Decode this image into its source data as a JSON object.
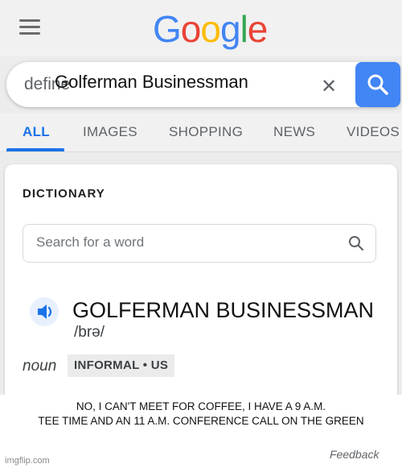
{
  "logo": {
    "letters": [
      "G",
      "o",
      "o",
      "g",
      "l",
      "e"
    ]
  },
  "search": {
    "prefix": "define",
    "query": "Golferman Businessman",
    "clear_icon": "close-icon",
    "button_icon": "search-icon",
    "button_color": "#4285f4"
  },
  "tabs": [
    {
      "label": "ALL",
      "active": true
    },
    {
      "label": "IMAGES",
      "active": false
    },
    {
      "label": "SHOPPING",
      "active": false
    },
    {
      "label": "NEWS",
      "active": false
    },
    {
      "label": "VIDEOS",
      "active": false
    }
  ],
  "dictionary": {
    "heading": "DICTIONARY",
    "search_placeholder": "Search for a word",
    "headword": "GOLFERMAN BUSINESSMAN",
    "pronunciation": "/brə/",
    "part_of_speech": "noun",
    "label": "INFORMAL • US",
    "caption_line1": "NO, I CAN'T MEET FOR COFFEE, I HAVE A 9 A.M.",
    "caption_line2": "TEE TIME AND AN 11 A.M. CONFERENCE CALL ON THE GREEN",
    "feedback": "Feedback"
  },
  "watermark": "imgflip.com",
  "colors": {
    "accent": "#1a73e8"
  }
}
